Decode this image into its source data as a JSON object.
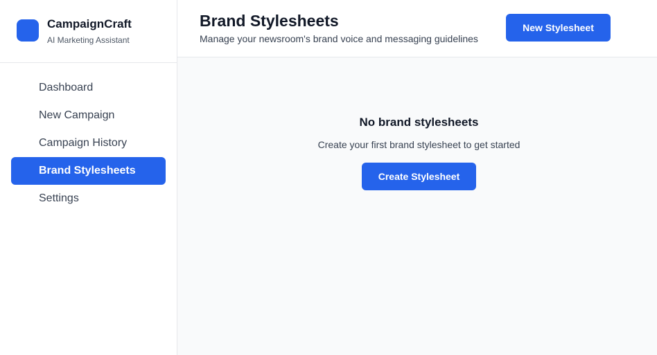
{
  "colors": {
    "accent": "#2563eb",
    "content_bg": "#f9fafb",
    "border": "#e5e7eb"
  },
  "brand": {
    "name": "CampaignCraft",
    "tagline": "AI Marketing Assistant",
    "logo_icon": "app-logo-square"
  },
  "sidebar": {
    "items": [
      {
        "label": "Dashboard",
        "active": false
      },
      {
        "label": "New Campaign",
        "active": false
      },
      {
        "label": "Campaign History",
        "active": false
      },
      {
        "label": "Brand Stylesheets",
        "active": true
      },
      {
        "label": "Settings",
        "active": false
      }
    ]
  },
  "header": {
    "title": "Brand Stylesheets",
    "subtitle": "Manage your newsroom's brand voice and messaging guidelines",
    "new_button_label": "New Stylesheet"
  },
  "empty_state": {
    "title": "No brand stylesheets",
    "description": "Create your first brand stylesheet to get started",
    "button_label": "Create Stylesheet"
  }
}
